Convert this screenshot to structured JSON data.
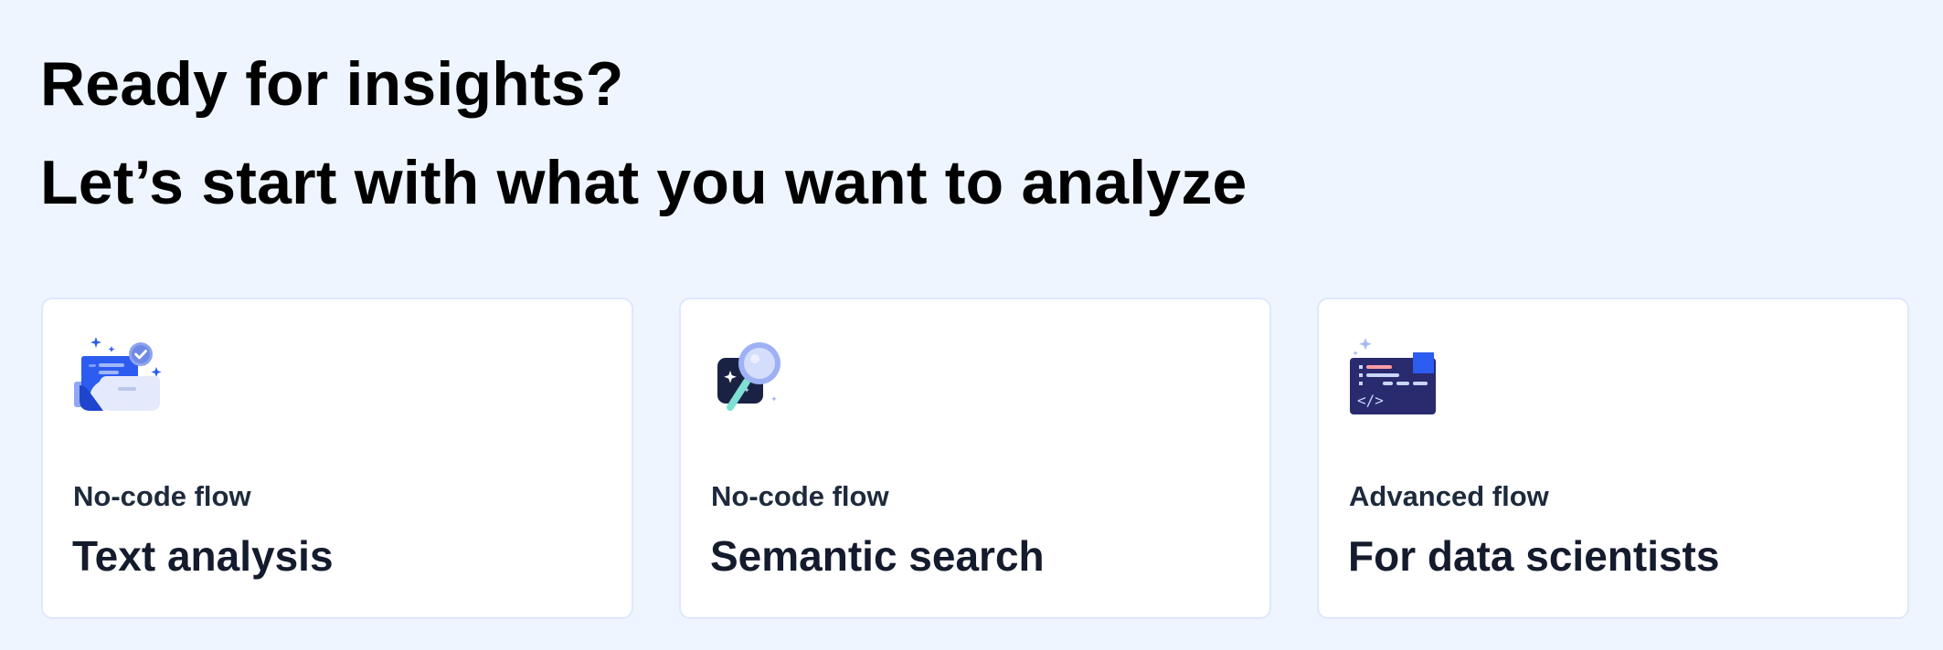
{
  "header": {
    "line1": "Ready for insights?",
    "line2": "Let’s start with what you want to analyze"
  },
  "cards": [
    {
      "icon": "document-folder-check-icon",
      "subtitle": "No-code flow",
      "title": "Text analysis"
    },
    {
      "icon": "magnifier-sparkle-icon",
      "subtitle": "No-code flow",
      "title": "Semantic search"
    },
    {
      "icon": "code-window-icon",
      "subtitle": "Advanced flow",
      "title": "For data scientists"
    }
  ],
  "colors": {
    "background": "#eef5fe",
    "card_background": "#ffffff",
    "card_border": "#dde8fb",
    "accent_blue": "#2c5cf0",
    "navy": "#2a2a6e"
  }
}
